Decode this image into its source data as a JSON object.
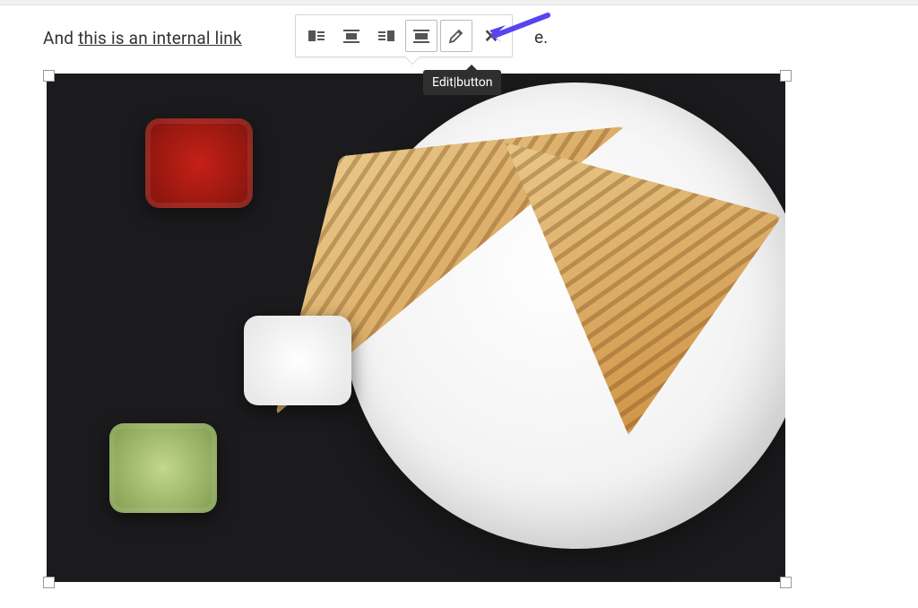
{
  "paragraph": {
    "before_link": "And ",
    "link_text": "this is an internal link",
    "after_link_tail": "e."
  },
  "toolbar": {
    "buttons": {
      "align_left": "align-left",
      "align_center": "align-center",
      "align_right": "align-right",
      "align_none": "align-none",
      "edit": "edit",
      "remove": "remove"
    }
  },
  "tooltip": {
    "text": "Edit|button"
  },
  "image": {
    "alt": "Plate with two grilled sandwich triangles and three dip containers (red, white, green) on a dark surface",
    "selected": true
  },
  "annotation": {
    "arrow_color": "#5844ef"
  }
}
